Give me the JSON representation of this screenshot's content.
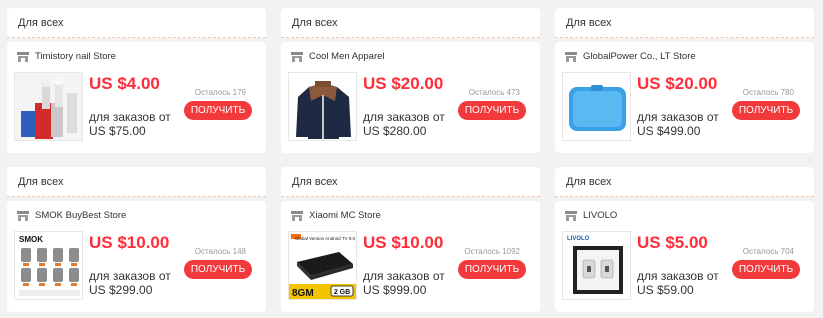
{
  "coupons": [
    {
      "header": "Для всех",
      "store": "Timistory nail Store",
      "price": "US $4.00",
      "order_label": "для заказов от",
      "order_min": "US $75.00",
      "remaining": "Осталось 179",
      "button": "ПОЛУЧИТЬ",
      "image": "nail-drill-bits"
    },
    {
      "header": "Для всех",
      "store": "Cool Men Apparel",
      "price": "US $20.00",
      "order_label": "для заказов от",
      "order_min": "US $280.00",
      "remaining": "Осталось 473",
      "button": "ПОЛУЧИТЬ",
      "image": "mens-jacket"
    },
    {
      "header": "Для всех",
      "store": "GlobalPower Co., LT Store",
      "price": "US $20.00",
      "order_label": "для заказов от",
      "order_min": "US $499.00",
      "remaining": "Осталось 780",
      "button": "ПОЛУЧИТЬ",
      "image": "blue-case"
    },
    {
      "header": "Для всех",
      "store": "SMOK BuyBest Store",
      "price": "US $10.00",
      "order_label": "для заказов от",
      "order_min": "US $299.00",
      "remaining": "Осталось 148",
      "button": "ПОЛУЧИТЬ",
      "image": "smok-coils",
      "image_text": "SMOK"
    },
    {
      "header": "Для всех",
      "store": "Xiaomi MC Store",
      "price": "US $10.00",
      "order_label": "для заказов от",
      "order_min": "US $999.00",
      "remaining": "Осталось 1092",
      "button": "ПОЛУЧИТЬ",
      "image": "tv-box",
      "image_text": "Global Version Android TV 9.0",
      "image_badge": "8GM",
      "image_badge2": "2 GB"
    },
    {
      "header": "Для всех",
      "store": "LIVOLO",
      "price": "US $5.00",
      "order_label": "для заказов от",
      "order_min": "US $59.00",
      "remaining": "Осталось 704",
      "button": "ПОЛУЧИТЬ",
      "image": "wall-socket",
      "image_text": "LIVOLO"
    }
  ],
  "colors": {
    "price": "#ff2c39",
    "button": "#f23a3c",
    "background": "#f2f2f2"
  }
}
